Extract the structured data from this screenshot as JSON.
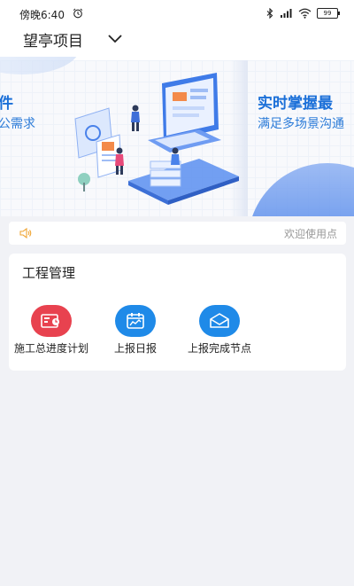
{
  "status_bar": {
    "time": "傍晚6:40",
    "battery": "99",
    "icons": [
      "alarm-icon",
      "bluetooth-icon",
      "signal-icon",
      "wifi-icon",
      "battery-icon"
    ]
  },
  "header": {
    "project_name": "望亭项目"
  },
  "banner": {
    "left_title": "件",
    "left_subtitle": "公需求",
    "right_title": "实时掌握最",
    "right_subtitle": "满足多场景沟通"
  },
  "notice": {
    "text": "欢迎使用点"
  },
  "engineering": {
    "title": "工程管理",
    "items": [
      {
        "label": "施工总进度计划",
        "icon": "gantt-plan-icon",
        "color": "#e8424f"
      },
      {
        "label": "上报日报",
        "icon": "daily-report-icon",
        "color": "#1f8ae8"
      },
      {
        "label": "上报完成节点",
        "icon": "mail-node-icon",
        "color": "#1f8ae8"
      }
    ]
  },
  "colors": {
    "accent_blue": "#1a6fd8",
    "accent_red": "#e8424f",
    "page_bg": "#f1f2f6"
  }
}
